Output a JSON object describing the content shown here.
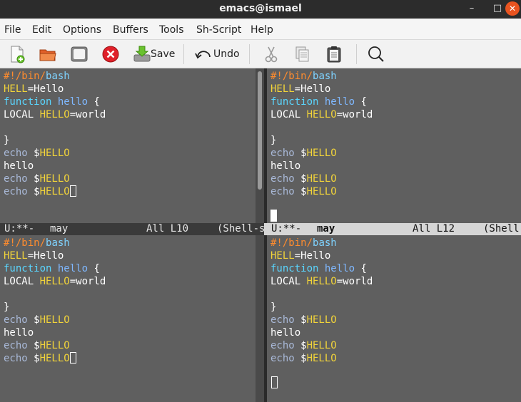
{
  "window": {
    "title": "emacs@ismael",
    "minimize_glyph": "–",
    "maximize_glyph": "□",
    "close_glyph": "✕"
  },
  "menu": {
    "items": [
      "File",
      "Edit",
      "Options",
      "Buffers",
      "Tools",
      "Sh-Script",
      "Help"
    ]
  },
  "toolbar": {
    "save_label": "Save",
    "undo_label": "Undo"
  },
  "buffer": {
    "lines_top": [
      [
        {
          "t": "#!/bin/",
          "c": "comment"
        },
        {
          "t": "bash",
          "c": "builtin"
        }
      ],
      [
        {
          "t": "HELL",
          "c": "var"
        },
        {
          "t": "=Hello",
          "c": ""
        }
      ],
      [
        {
          "t": "function",
          "c": "kw"
        },
        {
          "t": " ",
          "c": ""
        },
        {
          "t": "hello",
          "c": "fn"
        },
        {
          "t": " {",
          "c": ""
        }
      ],
      [
        {
          "t": "LOCAL ",
          "c": ""
        },
        {
          "t": "HELLO",
          "c": "var"
        },
        {
          "t": "=world",
          "c": ""
        }
      ],
      [],
      [
        {
          "t": "}",
          "c": ""
        }
      ],
      [
        {
          "t": "echo",
          "c": "echo"
        },
        {
          "t": " $",
          "c": ""
        },
        {
          "t": "HELLO",
          "c": "var"
        }
      ],
      [
        {
          "t": "hello",
          "c": ""
        }
      ],
      [
        {
          "t": "echo",
          "c": "echo"
        },
        {
          "t": " $",
          "c": ""
        },
        {
          "t": "HELLO",
          "c": "var"
        }
      ],
      [
        {
          "t": "echo",
          "c": "echo"
        },
        {
          "t": " $",
          "c": ""
        },
        {
          "t": "HELLO",
          "c": "var"
        }
      ]
    ]
  },
  "modelines": {
    "left": {
      "status": "U:**-",
      "buffer": "may",
      "position": "All L10",
      "mode": "(Shell-s"
    },
    "right": {
      "status": "U:**-",
      "buffer": "may",
      "position": "All L12",
      "mode": "(Shell"
    }
  },
  "colors": {
    "editor_bg": "#5f5f5f",
    "comment": "#ff8c2e",
    "keyword": "#5ad6ff",
    "variable": "#f2d43a",
    "active_modeline": "#d6d6d6",
    "inactive_modeline": "#3a3a3a"
  }
}
